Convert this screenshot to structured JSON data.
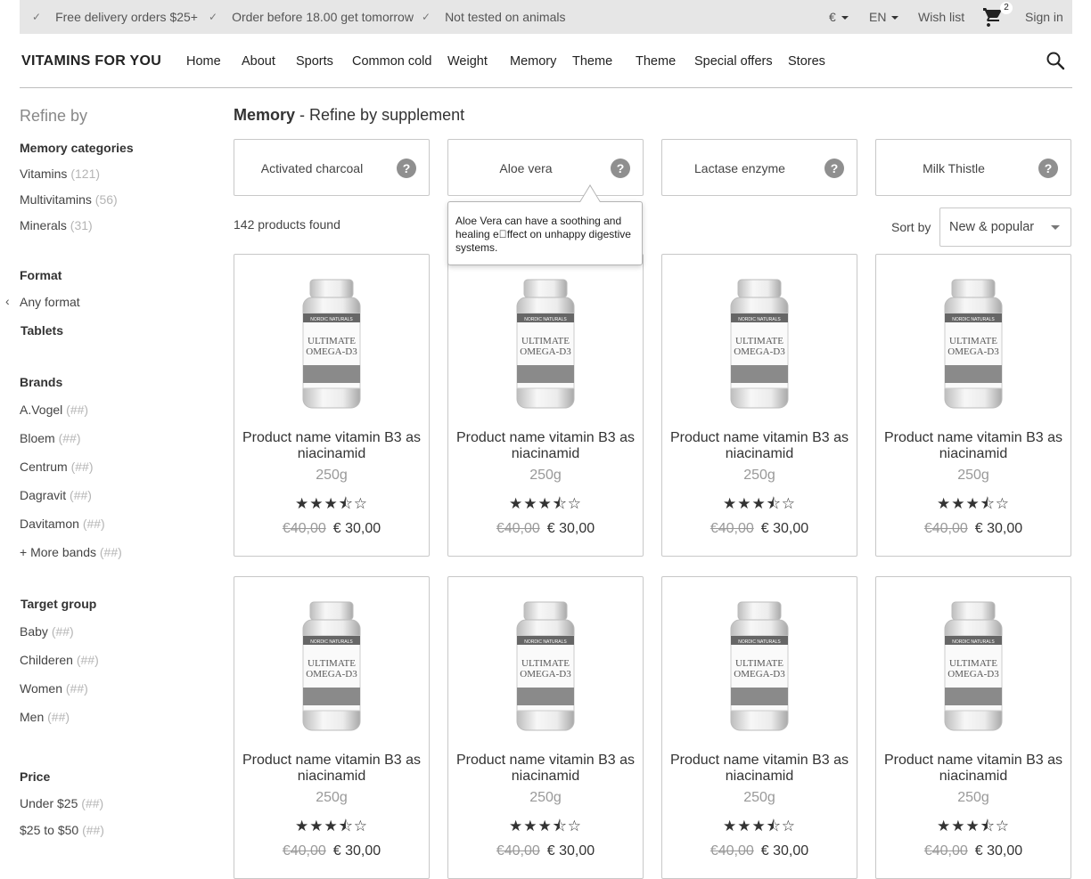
{
  "topbar": {
    "usps": [
      "Free delivery orders $25+",
      "Order before 18.00 get tomorrow",
      "Not tested on animals"
    ],
    "currency": "€",
    "language": "EN",
    "wishlist": "Wish list",
    "cart_count": "2",
    "signin": "Sign in"
  },
  "header": {
    "logo": "VITAMINS FOR YOU",
    "nav": [
      "Home",
      "About",
      "Sports",
      "Common cold",
      "Weight",
      "Memory",
      "Theme",
      "Theme",
      "Special offers",
      "Stores"
    ]
  },
  "sidebar": {
    "title": "Refine by",
    "memory_categories": {
      "heading": "Memory categories",
      "items": [
        {
          "label": "Vitamins",
          "count": "(121)"
        },
        {
          "label": "Multivitamins",
          "count": "(56)"
        },
        {
          "label": "Minerals",
          "count": "(31)"
        }
      ]
    },
    "format": {
      "heading": "Format",
      "back": "Any format",
      "selected": "Tablets"
    },
    "brands": {
      "heading": "Brands",
      "items": [
        {
          "label": "A.Vogel",
          "count": "(##)"
        },
        {
          "label": "Bloem",
          "count": "(##)"
        },
        {
          "label": "Centrum",
          "count": "(##)"
        },
        {
          "label": "Dagravit",
          "count": "(##)"
        },
        {
          "label": "Davitamon",
          "count": "(##)"
        },
        {
          "label": "+ More bands",
          "count": "(##)"
        }
      ]
    },
    "target_group": {
      "heading": "Target group",
      "items": [
        {
          "label": "Baby",
          "count": "(##)"
        },
        {
          "label": "Childeren",
          "count": "(##)"
        },
        {
          "label": "Women",
          "count": "(##)"
        },
        {
          "label": "Men",
          "count": "(##)"
        }
      ]
    },
    "price": {
      "heading": "Price",
      "items": [
        {
          "label": "Under $25",
          "count": "(##)"
        },
        {
          "label": "$25 to $50",
          "count": "(##)"
        }
      ]
    }
  },
  "main": {
    "title_bold": "Memory",
    "title_rest": " - Refine by supplement",
    "supplements": [
      "Activated charcoal",
      "Aloe vera",
      "Lactase enzyme",
      "Milk Thistle"
    ],
    "help_glyph": "?",
    "tooltip": "Aloe Vera can have a soothing and healing e\u0000ffect on unhappy digestive systems.",
    "found": "142 products found",
    "sort_label": "Sort by",
    "sort_value": "New & popular"
  },
  "product": {
    "name": "Product name vitamin B3 as niacinamid",
    "size": "250g",
    "stars": "★★★⯪☆",
    "rating": 3.5,
    "old_price": "€40,00",
    "price": "€ 30,00",
    "bottle_brand": "NORDIC NATURALS",
    "bottle_line1": "ULTIMATE",
    "bottle_line2": "OMEGA-D3"
  },
  "colors": {
    "topbar_bg": "#e6e6e6",
    "help_icon": "#8f8f8f",
    "border": "#c8c8c8"
  }
}
